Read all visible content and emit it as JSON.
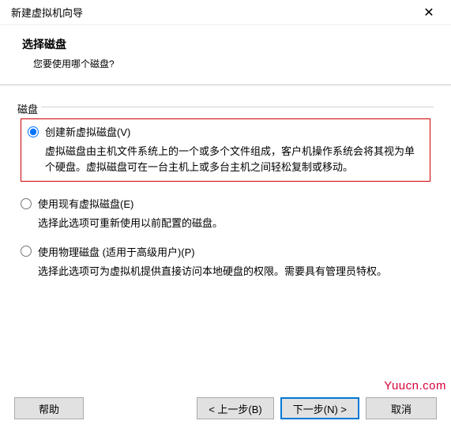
{
  "titlebar": {
    "title": "新建虚拟机向导",
    "close_glyph": "✕"
  },
  "header": {
    "title": "选择磁盘",
    "subtitle": "您要使用哪个磁盘?"
  },
  "fieldset": {
    "legend": "磁盘"
  },
  "options": [
    {
      "label": "创建新虚拟磁盘(V)",
      "desc": "虚拟磁盘由主机文件系统上的一个或多个文件组成，客户机操作系统会将其视为单个硬盘。虚拟磁盘可在一台主机上或多台主机之间轻松复制或移动。",
      "selected": true,
      "highlighted": true
    },
    {
      "label": "使用现有虚拟磁盘(E)",
      "desc": "选择此选项可重新使用以前配置的磁盘。",
      "selected": false,
      "highlighted": false
    },
    {
      "label": "使用物理磁盘 (适用于高级用户)(P)",
      "desc": "选择此选项可为虚拟机提供直接访问本地硬盘的权限。需要具有管理员特权。",
      "selected": false,
      "highlighted": false
    }
  ],
  "footer": {
    "help": "帮助",
    "back": "< 上一步(B)",
    "next": "下一步(N) >",
    "cancel": "取消"
  },
  "watermark": "Yuucn.com"
}
